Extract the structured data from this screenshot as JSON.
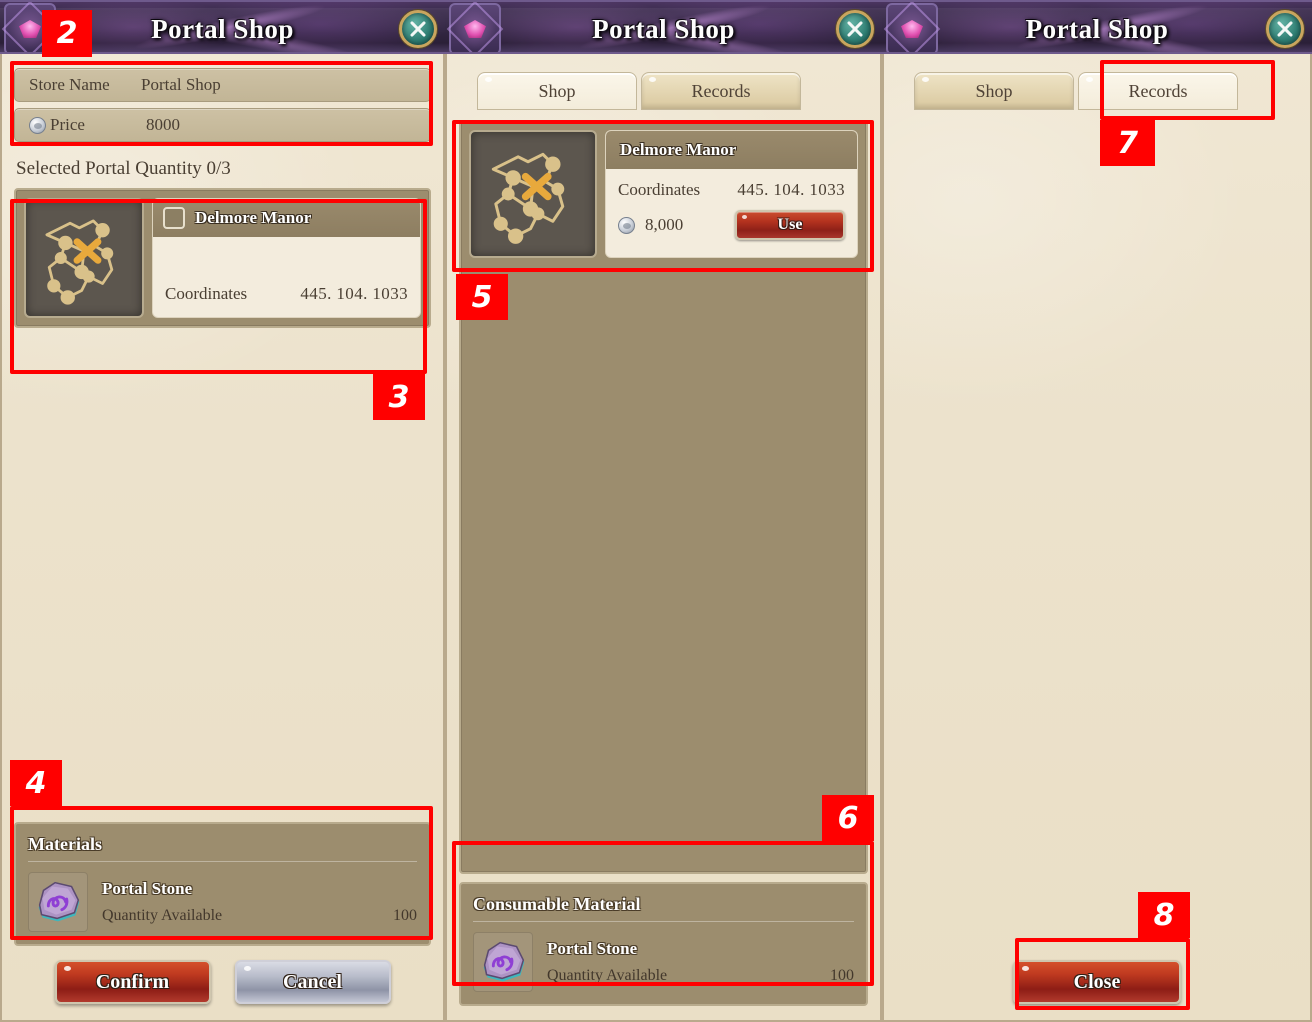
{
  "window_title": "Portal Shop",
  "icons": {
    "close": "close-icon",
    "emblem": "portal-emblem-icon",
    "coin": "currency-coin-icon",
    "map": "map-thumbnail-icon",
    "stone": "portal-stone-icon"
  },
  "panel1": {
    "title": "Portal Shop",
    "info_rows": [
      {
        "label": "Store Name",
        "value": "Portal Shop",
        "has_coin": false
      },
      {
        "label": "Price",
        "value": "8000",
        "has_coin": true
      }
    ],
    "selected_quantity_label": "Selected Portal Quantity 0/3",
    "entry": {
      "name": "Delmore Manor",
      "checked": false,
      "rows": [
        {
          "key": "Coordinates",
          "value": "445. 104. 1033"
        }
      ]
    },
    "materials": {
      "title": "Materials",
      "item_name": "Portal Stone",
      "qty_label": "Quantity Available",
      "qty_value": "100"
    },
    "buttons": {
      "confirm": "Confirm",
      "cancel": "Cancel"
    }
  },
  "panel2": {
    "title": "Portal Shop",
    "tabs": [
      {
        "label": "Shop",
        "active": true
      },
      {
        "label": "Records",
        "active": false
      }
    ],
    "entry": {
      "name": "Delmore Manor",
      "rows": [
        {
          "key": "Coordinates",
          "value": "445. 104. 1033"
        }
      ],
      "price": "8,000",
      "use_label": "Use"
    },
    "materials": {
      "title": "Consumable Material",
      "item_name": "Portal Stone",
      "qty_label": "Quantity Available",
      "qty_value": "100"
    }
  },
  "panel3": {
    "title": "Portal Shop",
    "tabs": [
      {
        "label": "Shop",
        "active": false
      },
      {
        "label": "Records",
        "active": true
      }
    ],
    "close_label": "Close"
  },
  "annotations": [
    {
      "id": "2",
      "num": "2"
    },
    {
      "id": "3",
      "num": "3"
    },
    {
      "id": "4",
      "num": "4"
    },
    {
      "id": "5",
      "num": "5"
    },
    {
      "id": "6",
      "num": "6"
    },
    {
      "id": "7",
      "num": "7"
    },
    {
      "id": "8",
      "num": "8"
    }
  ],
  "colors": {
    "annotation": "#ff0000",
    "panel_tan": "#9c8d6e",
    "parchment": "#ece2cc",
    "accent_red": "#b5331f"
  }
}
